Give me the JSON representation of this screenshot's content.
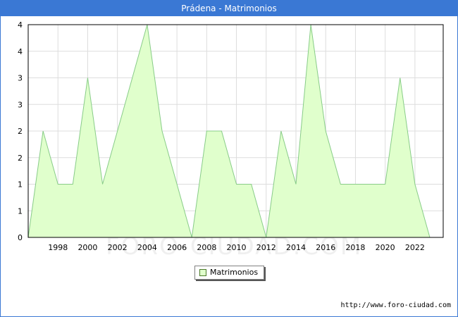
{
  "window": {
    "title": "Prádena - Matrimonios"
  },
  "watermark": "FORO-CIUDAD.COM",
  "source_url": "http://www.foro-ciudad.com",
  "colors": {
    "titlebar": "#3a78d4",
    "fill": "#e0ffcc",
    "line": "#88cc88",
    "grid": "#dddddd"
  },
  "chart_data": {
    "type": "area",
    "title": "Prádena - Matrimonios",
    "series": [
      {
        "name": "Matrimonios",
        "x": [
          1996,
          1997,
          1998,
          1999,
          2000,
          2001,
          2002,
          2003,
          2004,
          2005,
          2006,
          2007,
          2008,
          2009,
          2010,
          2011,
          2012,
          2013,
          2014,
          2015,
          2016,
          2017,
          2018,
          2019,
          2020,
          2021,
          2022,
          2023
        ],
        "values": [
          0,
          2,
          1,
          1,
          3,
          1,
          2,
          3,
          4,
          2,
          1,
          0,
          2,
          2,
          1,
          1,
          0,
          2,
          1,
          4,
          2,
          1,
          1,
          1,
          1,
          3,
          1,
          0
        ]
      }
    ],
    "xlim": [
      1996,
      2023.9
    ],
    "ylim": [
      0,
      4
    ],
    "x_ticks": [
      1998,
      2000,
      2002,
      2004,
      2006,
      2008,
      2010,
      2012,
      2014,
      2016,
      2018,
      2020,
      2022
    ],
    "x_tick_labels": [
      "1998",
      "2000",
      "2002",
      "2004",
      "2006",
      "2008",
      "2010",
      "2012",
      "2014",
      "2016",
      "2018",
      "2020",
      "2022"
    ],
    "y_tick_labels": [
      "0",
      "1",
      "1",
      "2",
      "2",
      "3",
      "3",
      "4",
      "4"
    ],
    "grid": true,
    "legend": "bottom-center"
  }
}
